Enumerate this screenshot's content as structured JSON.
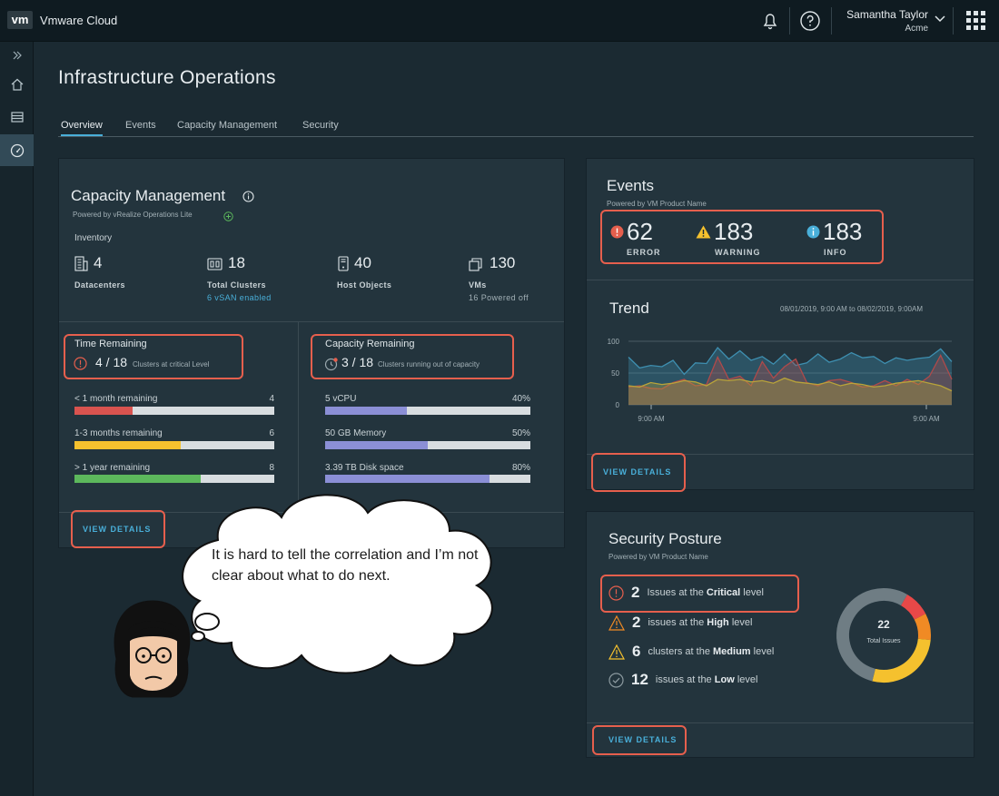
{
  "app": {
    "logo": "vm",
    "title": "Vmware Cloud"
  },
  "user": {
    "name": "Samantha Taylor",
    "org": "Acme"
  },
  "page": {
    "title": "Infrastructure Operations"
  },
  "tabs": [
    {
      "label": "Overview",
      "active": true
    },
    {
      "label": "Events"
    },
    {
      "label": "Capacity Management"
    },
    {
      "label": "Security"
    }
  ],
  "capacity": {
    "title": "Capacity Management",
    "powered_by": "Powered by vRealize Operations Lite",
    "inventory_label": "Inventory",
    "inventory": [
      {
        "value": "4",
        "label": "Datacenters",
        "sub": ""
      },
      {
        "value": "18",
        "label": "Total Clusters",
        "sub": "6 vSAN enabled"
      },
      {
        "value": "40",
        "label": "Host Objects",
        "sub": ""
      },
      {
        "value": "130",
        "label": "VMs",
        "sub": "16 Powered off"
      }
    ],
    "time_remaining": {
      "title": "Time Remaining",
      "count": "4 / 18",
      "desc": "Clusters at critical Level",
      "bars": [
        {
          "label": "< 1 month remaining",
          "value": "4",
          "fill": 0.29,
          "color": "#d9534f"
        },
        {
          "label": "1-3 months remaining",
          "value": "6",
          "fill": 0.53,
          "color": "#f5c12e"
        },
        {
          "label": "> 1 year remaining",
          "value": "8",
          "fill": 0.63,
          "color": "#5cb85c"
        }
      ]
    },
    "capacity_remaining": {
      "title": "Capacity Remaining",
      "count": "3 / 18",
      "desc": "Clusters running out of capacity",
      "bars": [
        {
          "label": "5 vCPU",
          "value": "40%",
          "fill": 0.4,
          "color": "#8b8fd6"
        },
        {
          "label": "50 GB Memory",
          "value": "50%",
          "fill": 0.5,
          "color": "#8b8fd6"
        },
        {
          "label": "3.39 TB Disk space",
          "value": "80%",
          "fill": 0.8,
          "color": "#8b8fd6"
        }
      ]
    },
    "view_details": "VIEW DETAILS"
  },
  "events": {
    "title": "Events",
    "powered_by": "Powered by VM Product Name",
    "counts": [
      {
        "value": "62",
        "label": "ERROR",
        "color": "#e65f4d"
      },
      {
        "value": "183",
        "label": "WARNING",
        "color": "#f5c12e"
      },
      {
        "value": "183",
        "label": "INFO",
        "color": "#49afd9"
      }
    ],
    "trend_title": "Trend",
    "trend_range": "08/01/2019, 9:00 AM  to  08/02/2019, 9:00AM",
    "view_details": "VIEW DETAILS"
  },
  "chart_data": {
    "type": "area",
    "x": [
      1,
      2,
      3,
      4,
      5,
      6,
      7,
      8,
      9,
      10,
      11,
      12,
      13,
      14,
      15,
      16,
      17,
      18,
      19,
      20,
      21,
      22,
      23,
      24,
      25,
      26,
      27,
      28,
      29,
      30
    ],
    "x_tick_labels": [
      "9:00 AM",
      "9:00 AM"
    ],
    "ylim": [
      0,
      100
    ],
    "y_ticks": [
      0,
      50,
      100
    ],
    "series": [
      {
        "color": "#3e8fb0",
        "values": [
          75,
          58,
          62,
          60,
          70,
          48,
          66,
          65,
          90,
          72,
          85,
          70,
          76,
          64,
          80,
          62,
          66,
          80,
          67,
          72,
          82,
          74,
          76,
          65,
          74,
          70,
          73,
          75,
          88,
          68
        ]
      },
      {
        "color": "#b04a4a",
        "values": [
          28,
          30,
          26,
          25,
          35,
          40,
          30,
          32,
          75,
          40,
          45,
          30,
          68,
          42,
          60,
          72,
          35,
          30,
          38,
          40,
          35,
          28,
          30,
          38,
          30,
          40,
          32,
          45,
          78,
          40
        ]
      },
      {
        "color": "#b8a33a",
        "values": [
          30,
          28,
          35,
          32,
          34,
          38,
          36,
          30,
          40,
          38,
          40,
          36,
          38,
          34,
          42,
          36,
          34,
          32,
          36,
          30,
          34,
          32,
          28,
          30,
          34,
          36,
          38,
          34,
          30,
          22
        ]
      }
    ]
  },
  "security": {
    "title": "Security Posture",
    "powered_by": "Powered by VM Product Name",
    "rows": [
      {
        "num": "2",
        "pre": "Issues at the",
        "level": "Critical",
        "post": "level",
        "color": "#e65f4d"
      },
      {
        "num": "2",
        "pre": "issues at the",
        "level": "High",
        "post": "level",
        "color": "#f08a24"
      },
      {
        "num": "6",
        "pre": "clusters at the",
        "level": "Medium",
        "post": "level",
        "color": "#f5c12e"
      },
      {
        "num": "12",
        "pre": "issues at the",
        "level": "Low",
        "post": "level",
        "color": "#8c9aa0"
      }
    ],
    "donut": {
      "total": "22",
      "label": "Total Issues",
      "segments": [
        {
          "value": 2,
          "color": "#e84848"
        },
        {
          "value": 2,
          "color": "#f08a24"
        },
        {
          "value": 6,
          "color": "#f5c12e"
        },
        {
          "value": 12,
          "color": "#6f7d84"
        }
      ]
    },
    "view_details": "VIEW DETAILS"
  },
  "comment": {
    "text": "It is hard to tell the correlation and I’m not clear about what to do next."
  }
}
